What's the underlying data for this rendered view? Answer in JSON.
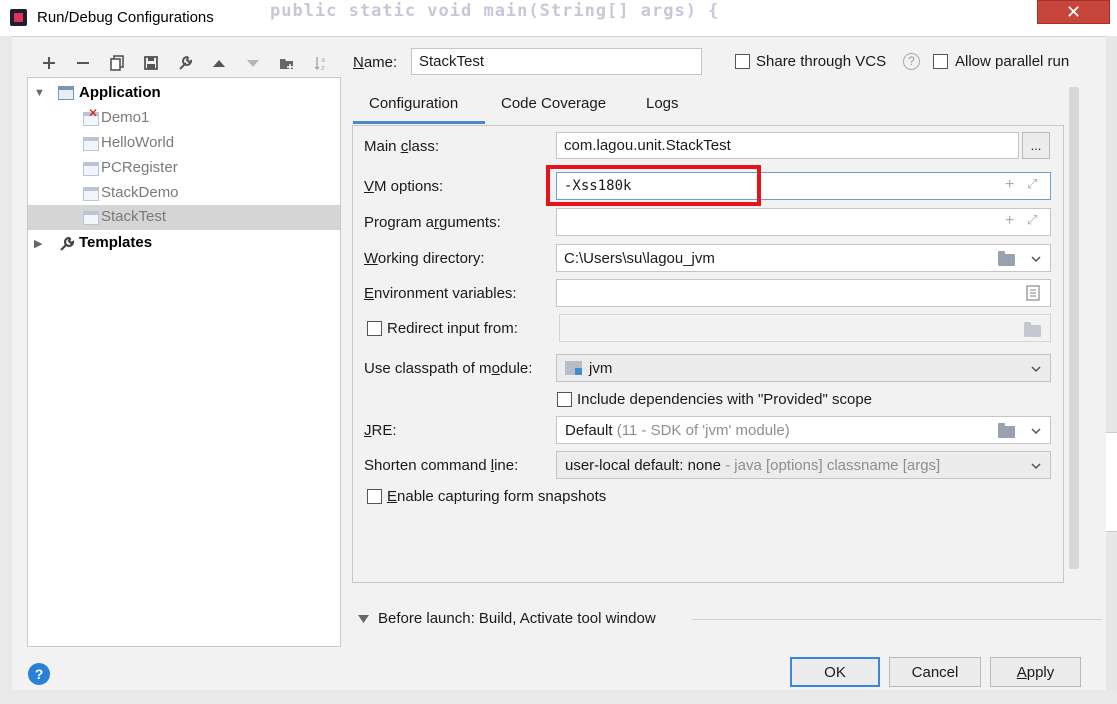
{
  "window": {
    "title": "Run/Debug Configurations",
    "background_code": "public static void main(String[] args) {",
    "close_glyph": "✕"
  },
  "toolbar": {
    "icons": [
      "add-icon",
      "remove-icon",
      "copy-icon",
      "save-icon",
      "wrench-icon",
      "move-up-icon",
      "move-down-icon",
      "folder-add-icon",
      "sort-icon"
    ]
  },
  "tree": {
    "application": "Application",
    "items": [
      "Demo1",
      "HelloWorld",
      "PCRegister",
      "StackDemo",
      "StackTest"
    ],
    "selected": "StackTest",
    "templates": "Templates"
  },
  "header": {
    "name_label": "Name:",
    "name_value": "StackTest",
    "share_vcs": "Share through VCS",
    "allow_parallel": "Allow parallel run"
  },
  "tabs": [
    "Configuration",
    "Code Coverage",
    "Logs"
  ],
  "form": {
    "main_class_label": "Main class:",
    "main_class_value": "com.lagou.unit.StackTest",
    "browse_label": "...",
    "vm_options_label": "VM options:",
    "vm_options_value": "-Xss180k",
    "program_arguments_label": "Program arguments:",
    "program_arguments_value": "",
    "working_directory_label": "Working directory:",
    "working_directory_value": "C:\\Users\\su\\lagou_jvm",
    "environment_variables_label": "Environment variables:",
    "environment_variables_value": "",
    "redirect_input_label": "Redirect input from:",
    "classpath_label": "Use classpath of module:",
    "classpath_value": "jvm",
    "include_dependencies_label": "Include dependencies with \"Provided\" scope",
    "jre_label": "JRE:",
    "jre_value": "Default",
    "jre_detail": "(11 - SDK of 'jvm' module)",
    "shorten_label": "Shorten command line:",
    "shorten_value": "user-local default: none",
    "shorten_detail": "- java [options] classname [args]",
    "snapshots_label": "Enable capturing form snapshots"
  },
  "before_launch": "Before launch: Build, Activate tool window",
  "buttons": {
    "ok": "OK",
    "cancel": "Cancel",
    "apply": "Apply",
    "help": "?"
  },
  "colors": {
    "highlight": "#e3141a",
    "accent": "#4a88c7"
  }
}
